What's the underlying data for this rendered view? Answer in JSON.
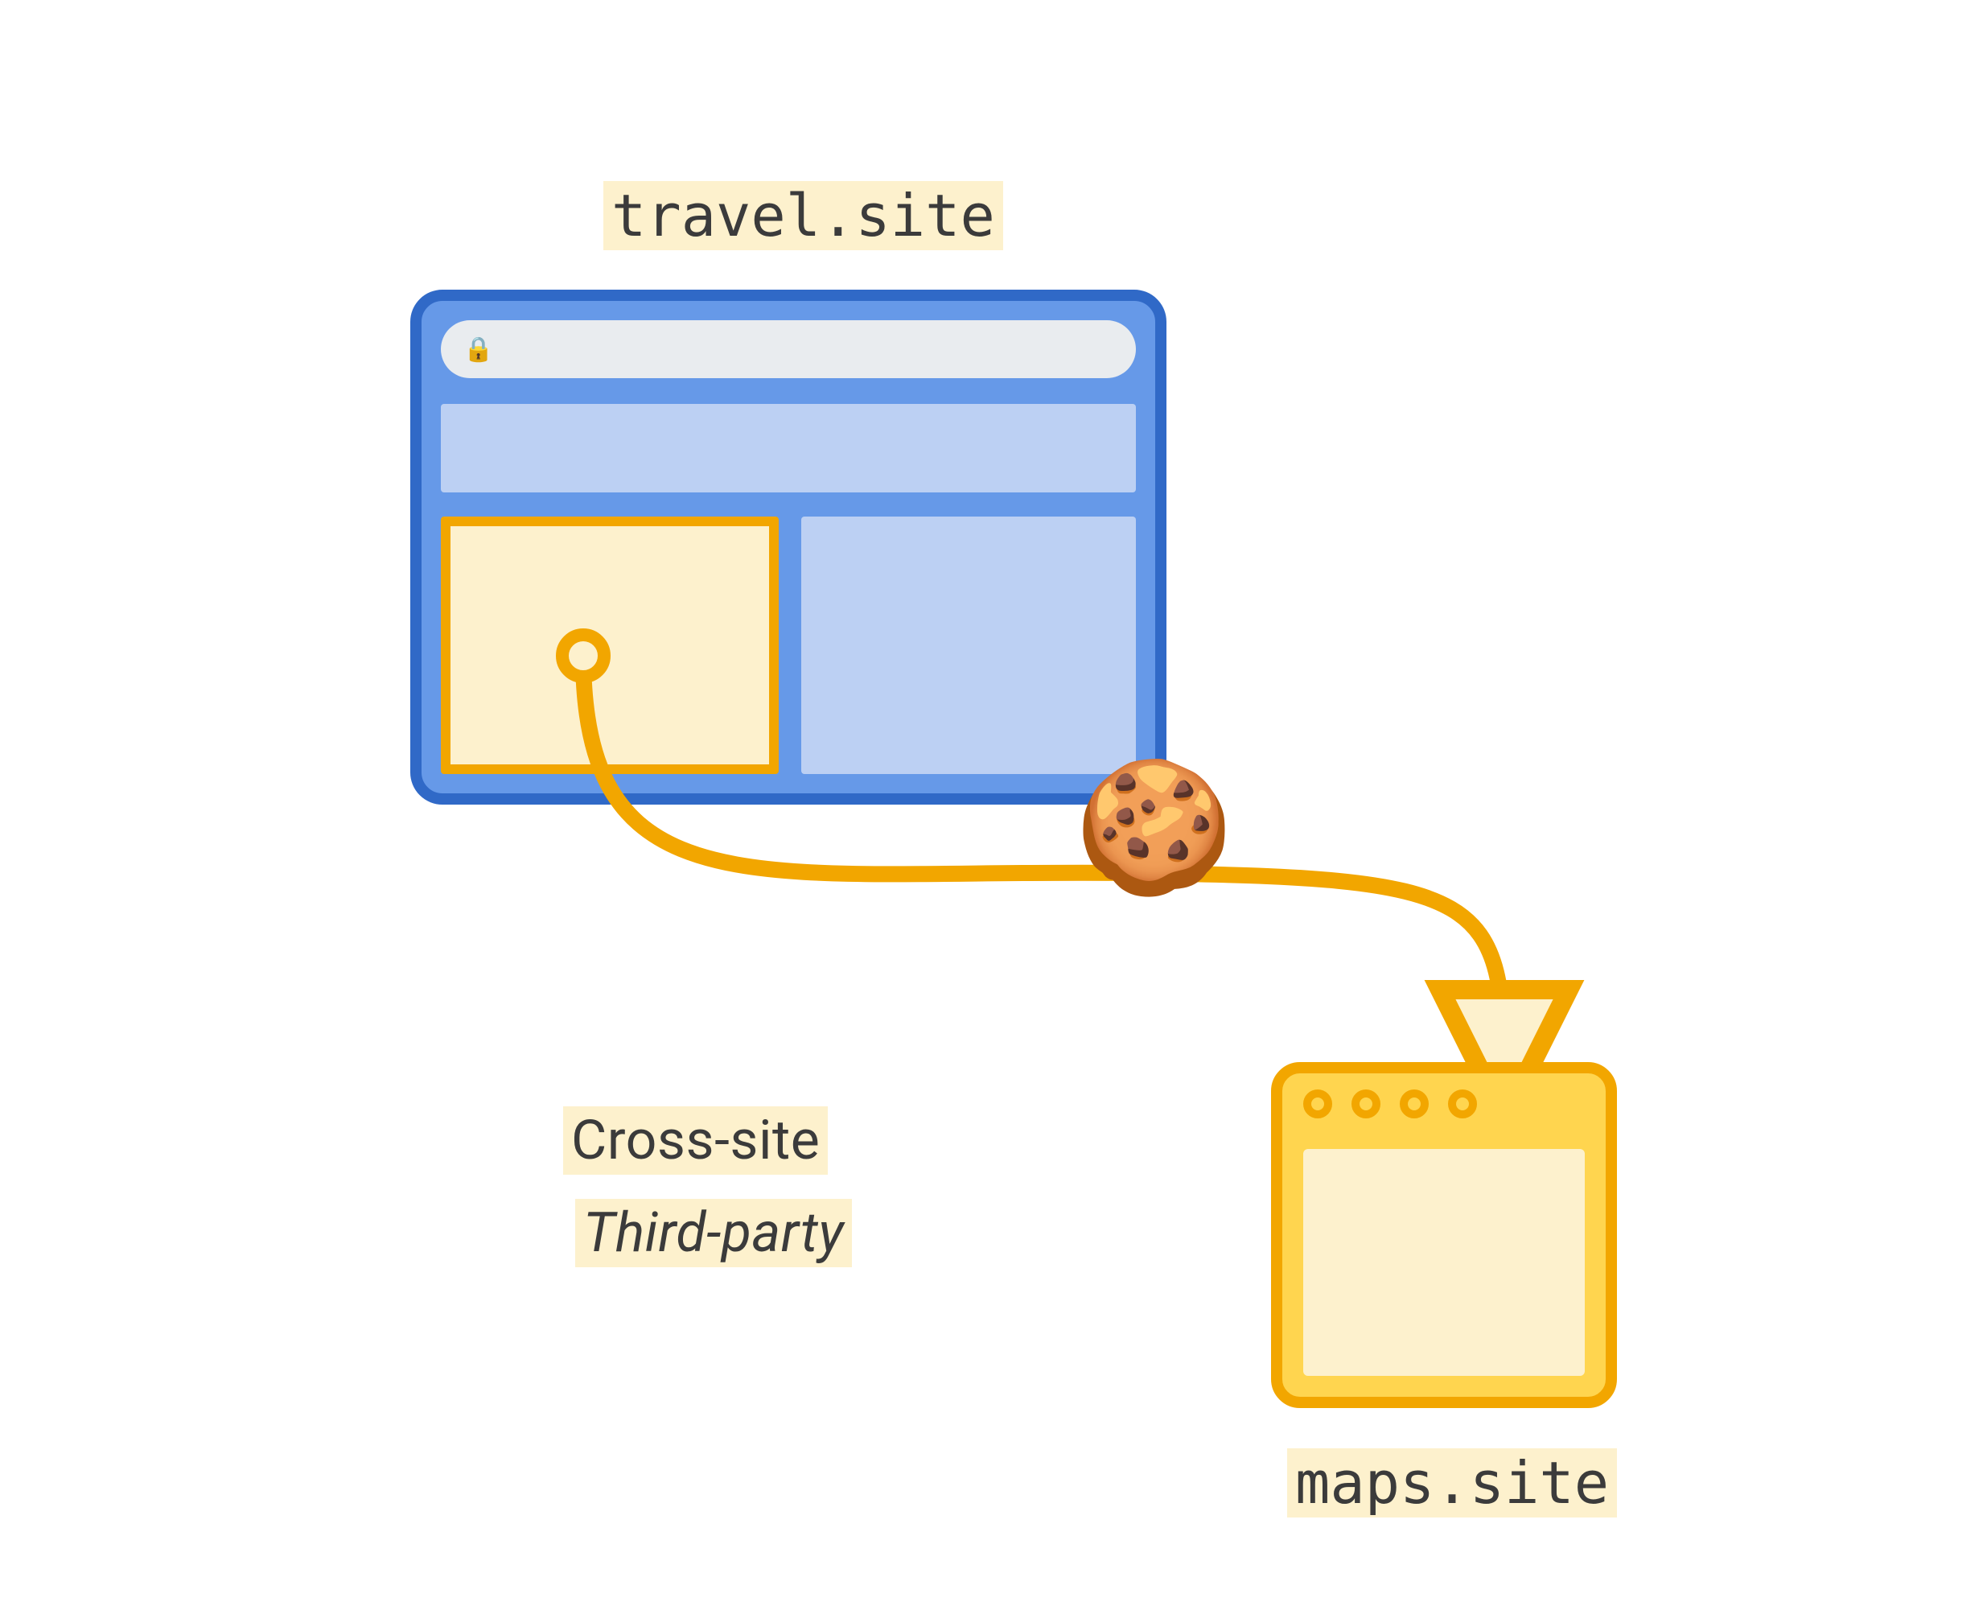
{
  "labels": {
    "top_site": "travel.site",
    "bottom_site": "maps.site",
    "cross_site": "Cross-site",
    "third_party": "Third-party"
  },
  "icons": {
    "lock": "🔒",
    "cookie": "🍪"
  },
  "colors": {
    "browser_border": "#3069c7",
    "browser_fill": "#6699e8",
    "panel_light": "#bcd0f3",
    "highlight_fill": "#fdf1cd",
    "highlight_border": "#f2a600",
    "maps_fill": "#ffd54f",
    "arrow": "#f2a600"
  }
}
